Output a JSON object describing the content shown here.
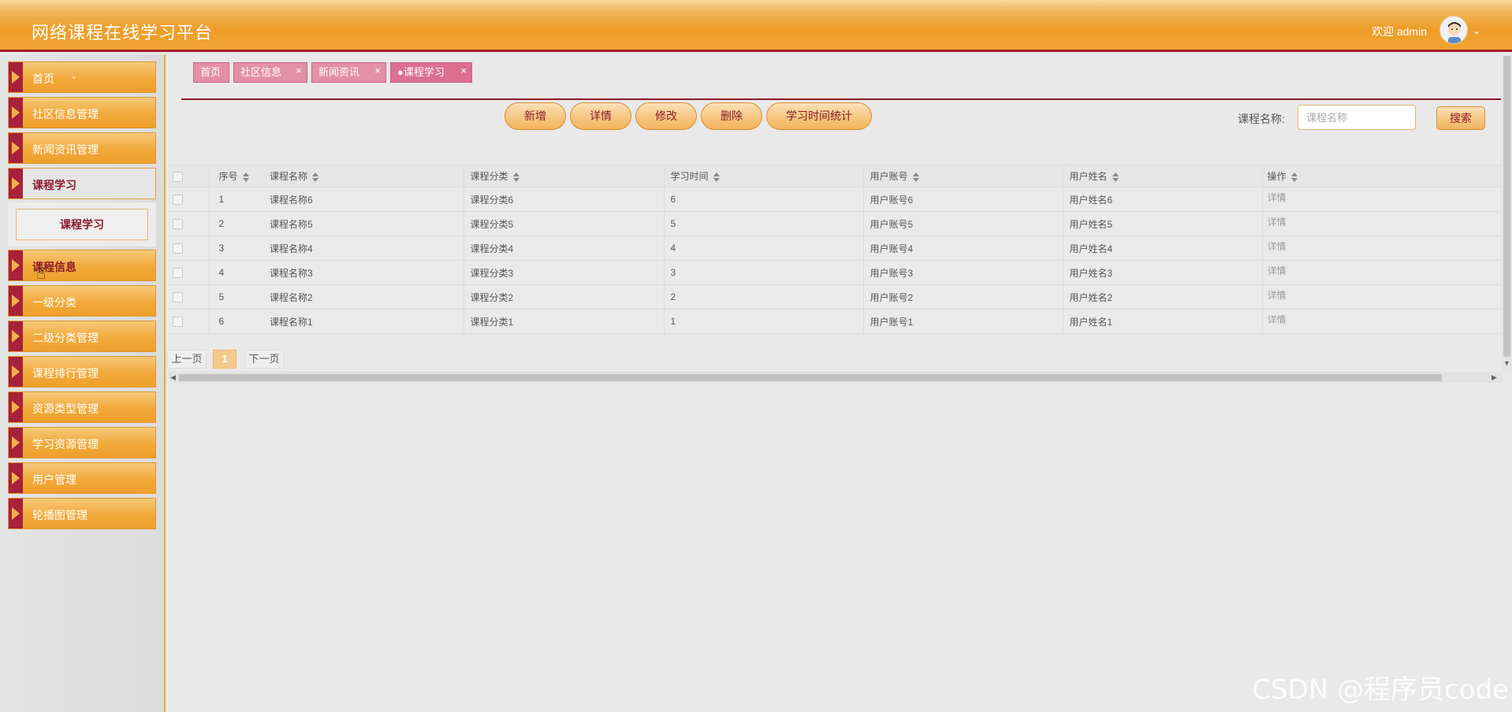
{
  "header": {
    "title": "网络课程在线学习平台",
    "welcome": "欢迎 admin"
  },
  "sidebar": {
    "items": [
      {
        "label": "首页"
      },
      {
        "label": "社区信息管理"
      },
      {
        "label": "新闻资讯管理"
      },
      {
        "label": "课程学习"
      },
      {
        "label": "课程信息"
      },
      {
        "label": "一级分类"
      },
      {
        "label": "二级分类管理"
      },
      {
        "label": "课程排行管理"
      },
      {
        "label": "资源类型管理"
      },
      {
        "label": "学习资源管理"
      },
      {
        "label": "用户管理"
      },
      {
        "label": "轮播图管理"
      }
    ],
    "submenu": {
      "label": "课程学习"
    }
  },
  "tabs": [
    {
      "label": "首页"
    },
    {
      "label": "社区信息"
    },
    {
      "label": "新闻资讯"
    },
    {
      "label": "●课程学习"
    }
  ],
  "toolbar": {
    "add": "新增",
    "detail": "详情",
    "edit": "修改",
    "delete": "删除",
    "stats": "学习时间统计"
  },
  "search": {
    "label": "课程名称:",
    "placeholder": "课程名称",
    "button": "搜索"
  },
  "table": {
    "headers": [
      "序号",
      "课程名称",
      "课程分类",
      "学习时间",
      "用户账号",
      "用户姓名",
      "操作"
    ],
    "rows": [
      {
        "seq": "1",
        "name": "课程名称6",
        "category": "课程分类6",
        "time": "6",
        "account": "用户账号6",
        "username": "用户姓名6",
        "op": "详情"
      },
      {
        "seq": "2",
        "name": "课程名称5",
        "category": "课程分类5",
        "time": "5",
        "account": "用户账号5",
        "username": "用户姓名5",
        "op": "详情"
      },
      {
        "seq": "3",
        "name": "课程名称4",
        "category": "课程分类4",
        "time": "4",
        "account": "用户账号4",
        "username": "用户姓名4",
        "op": "详情"
      },
      {
        "seq": "4",
        "name": "课程名称3",
        "category": "课程分类3",
        "time": "3",
        "account": "用户账号3",
        "username": "用户姓名3",
        "op": "详情"
      },
      {
        "seq": "5",
        "name": "课程名称2",
        "category": "课程分类2",
        "time": "2",
        "account": "用户账号2",
        "username": "用户姓名2",
        "op": "详情"
      },
      {
        "seq": "6",
        "name": "课程名称1",
        "category": "课程分类1",
        "time": "1",
        "account": "用户账号1",
        "username": "用户姓名1",
        "op": "详情"
      }
    ]
  },
  "pagination": {
    "prev": "上一页",
    "current": "1",
    "next": "下一页"
  },
  "watermark": "CSDN @程序员code",
  "colors": {
    "accent": "#ee9d27",
    "brand_dark": "#a81d2a",
    "tab_pink": "#e38fa8"
  }
}
